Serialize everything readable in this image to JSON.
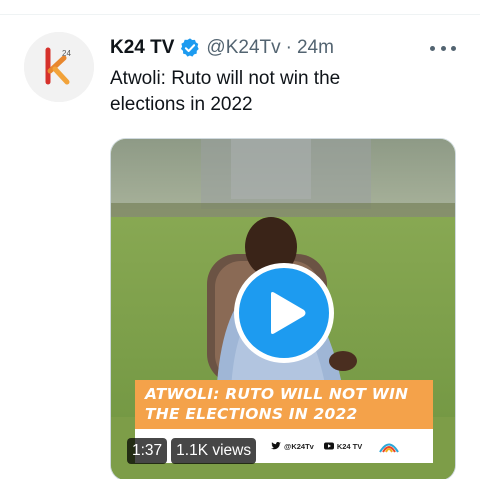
{
  "tweet": {
    "display_name": "K24 TV",
    "handle": "@K24Tv",
    "separator": "·",
    "time": "24m",
    "text_line1": "Atwoli: Ruto will not win the",
    "text_line2": "elections in 2022"
  },
  "avatar": {
    "logo_text": "K",
    "logo_sup": "24"
  },
  "video": {
    "duration": "1:37",
    "views": "1.1K views",
    "banner_line1": "ATWOLI: RUTO WILL NOT WIN",
    "banner_line2": "THE ELECTIONS IN 2022",
    "strip_twitter": "@K24Tv",
    "strip_youtube": "K24 TV"
  },
  "icons": {
    "verified": "verified-badge-icon",
    "more": "more-options-icon",
    "play": "play-icon"
  },
  "colors": {
    "accent": "#1d9bf0",
    "secondary_text": "#536471",
    "banner": "#f4a24a"
  }
}
